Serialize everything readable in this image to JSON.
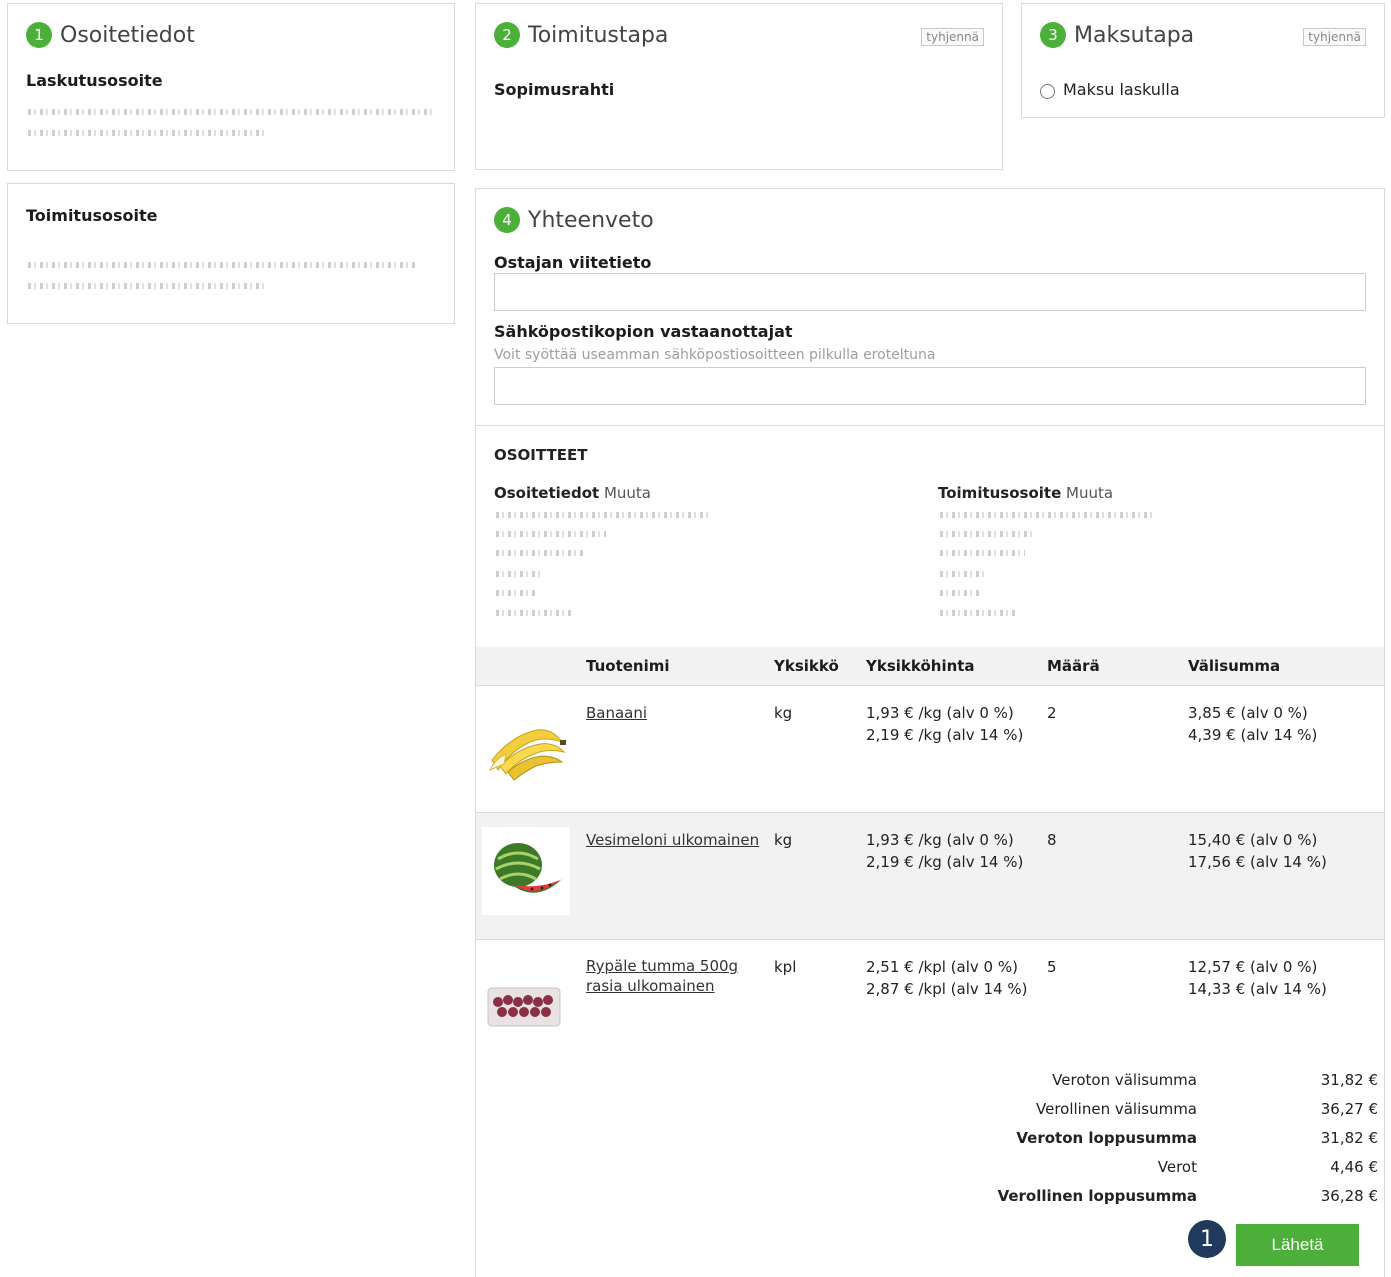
{
  "steps": {
    "address": {
      "num": "1",
      "title": "Osoitetiedot",
      "billing_heading": "Laskutusosoite",
      "delivery_heading": "Toimitusosoite"
    },
    "delivery": {
      "num": "2",
      "title": "Toimitustapa",
      "clear": "tyhjennä",
      "method": "Sopimusrahti"
    },
    "payment": {
      "num": "3",
      "title": "Maksutapa",
      "clear": "tyhjennä",
      "option": "Maksu laskulla"
    },
    "summary": {
      "num": "4",
      "title": "Yhteenveto",
      "ref_label": "Ostajan viitetieto",
      "ref_value": "",
      "email_label": "Sähköpostikopion vastaanottajat",
      "email_hint": "Voit syöttää useamman sähköpostiosoitteen pilkulla eroteltuna",
      "email_value": ""
    }
  },
  "addresses": {
    "heading": "OSOITTEET",
    "left_title": "Osoitetiedot",
    "left_action": "Muuta",
    "right_title": "Toimitusosoite",
    "right_action": "Muuta"
  },
  "table": {
    "headers": [
      "Tuotenimi",
      "Yksikkö",
      "Yksikköhinta",
      "Määrä",
      "Välisumma"
    ],
    "rows": [
      {
        "image": "banana-image",
        "name": "Banaani",
        "unit": "kg",
        "price1": "1,93 € /kg (alv 0 %)",
        "price2": "2,19 € /kg (alv 14 %)",
        "qty": "2",
        "sub1": "3,85 € (alv 0 %)",
        "sub2": "4,39 € (alv 14 %)"
      },
      {
        "image": "watermelon-image",
        "name": "Vesimeloni ulkomainen",
        "unit": "kg",
        "price1": "1,93 € /kg (alv 0 %)",
        "price2": "2,19 € /kg (alv 14 %)",
        "qty": "8",
        "sub1": "15,40 € (alv 0 %)",
        "sub2": "17,56 € (alv 14 %)"
      },
      {
        "image": "grapes-image",
        "name": "Rypäle tumma 500g rasia ulkomainen",
        "unit": "kpl",
        "price1": "2,51 € /kpl (alv 0 %)",
        "price2": "2,87 € /kpl (alv 14 %)",
        "qty": "5",
        "sub1": "12,57 € (alv 0 %)",
        "sub2": "14,33 € (alv 14 %)"
      }
    ]
  },
  "totals": [
    {
      "label": "Veroton välisumma",
      "value": "31,82 €",
      "bold": false
    },
    {
      "label": "Verollinen välisumma",
      "value": "36,27 €",
      "bold": false
    },
    {
      "label": "Veroton loppusumma",
      "value": "31,82 €",
      "bold": true
    },
    {
      "label": "Verot",
      "value": "4,46 €",
      "bold": false
    },
    {
      "label": "Verollinen loppusumma",
      "value": "36,28 €",
      "bold": true
    }
  ],
  "send_button": "Lähetä",
  "badge": "1",
  "colors": {
    "accent_green": "#4caf3a",
    "badge_navy": "#1f3a5c"
  }
}
